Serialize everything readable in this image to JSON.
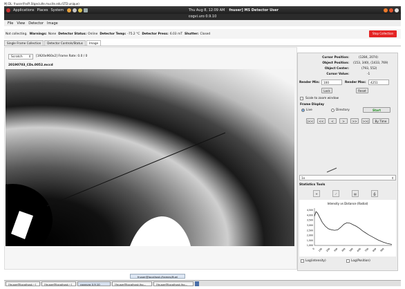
{
  "vnc_window_title": "MJ DL: fnuser(fnsPi.Stgeciulte.mucite.edu:STD:unique)",
  "top_panel": {
    "menus": [
      "Applications",
      "Places",
      "System"
    ],
    "clock": "Thu Aug 8, 12:09 AM",
    "user": "fnuser] MS Detector User"
  },
  "window": {
    "title": "cogvi.uro 0.9.10"
  },
  "menu": [
    "File",
    "View",
    "Detector",
    "Image"
  ],
  "status": {
    "prefix": "Not collecting.",
    "warnings_label": "Warnings:",
    "warnings_value": "None",
    "detector_status_label": "Detector Status:",
    "detector_status_value": "Online",
    "detector_temp_label": "Detector Temp:",
    "detector_temp_value": "-75.2 °C",
    "detector_press_label": "Detector Press:",
    "detector_press_value": "6.03 mT",
    "shutter_label": "Shutter:",
    "shutter_value": "Closed",
    "stop_button": "Stop Collection"
  },
  "tabs": [
    {
      "label": "Single Frame Collection",
      "active": false
    },
    {
      "label": "Detector Controls/Status",
      "active": false
    },
    {
      "label": "Image",
      "active": true
    }
  ],
  "viewer": {
    "scale": "Scratch",
    "size_label": "[1920x960x2] Frame Rate: 0.0 / 0",
    "filename": "20190703_CDs.0052.mccd"
  },
  "info": {
    "cursor_position_label": "Cursor Position:",
    "cursor_position_value": "(1284, 2074)",
    "object_position_label": "Object Position:",
    "object_position_value": "(153, 340), (1433, 769)",
    "object_center_label": "Object Center:",
    "object_center_value": "(793, 552)",
    "cursor_value_label": "Cursor Value:",
    "cursor_value_value": "-1"
  },
  "render": {
    "min_label": "Render Min:",
    "min_value": "100",
    "max_label": "Render Max:",
    "max_value": "4251",
    "lock": "Lock",
    "reset": "Reset"
  },
  "scale_to_zoom": "Scale to zoom window",
  "frame_display": {
    "title": "Frame Display",
    "live": "Live",
    "directory": "Directory",
    "start": "Start",
    "nav_buttons": [
      "|<<",
      "<<",
      "<",
      ">",
      ">>",
      ">>|"
    ],
    "by_time": "By Time"
  },
  "zoom_select": "1x",
  "stats": {
    "title": "Statistics Tools",
    "chart_title": "Intensity vs Distance (Radial)",
    "log_intensity": "Log(intensity)",
    "log_position": "Log(Position)"
  },
  "chart_data": {
    "type": "line",
    "title": "Intensity vs Distance (Radial)",
    "xlabel": "",
    "ylabel": "",
    "x_ticks": [
      "0",
      "100",
      "200",
      "300",
      "400",
      "500",
      "600",
      "700",
      "800",
      "900"
    ],
    "y_ticks": [
      "1,000",
      "1,500",
      "2,000",
      "2,500",
      "3,000",
      "3,500",
      "4,000",
      "4,500"
    ],
    "xlim": [
      0,
      1000
    ],
    "ylim": [
      1000,
      4700
    ],
    "series": [
      {
        "x": [
          0,
          20,
          40,
          60,
          80,
          100,
          140,
          180,
          220,
          260,
          300,
          340,
          380,
          420,
          460,
          500,
          540,
          580,
          620,
          660,
          700,
          760,
          820,
          880,
          940,
          1000
        ],
        "values": [
          3900,
          4350,
          4200,
          3900,
          3600,
          3300,
          2900,
          2650,
          2550,
          2500,
          2550,
          2800,
          3100,
          3250,
          3200,
          3050,
          2900,
          2700,
          2450,
          2250,
          2050,
          1800,
          1550,
          1350,
          1200,
          1100
        ]
      }
    ]
  },
  "taskbar": {
    "items": [
      "[fnuser@localhost:~]",
      "[fnuser@localhost:~]",
      "cogvura 0.9.10",
      "[fnuser@localhost:/ho...",
      "[fnuser@localhost:/ho..."
    ]
  },
  "bottom_chip": "fnuser@localhost:/frames/fluel"
}
